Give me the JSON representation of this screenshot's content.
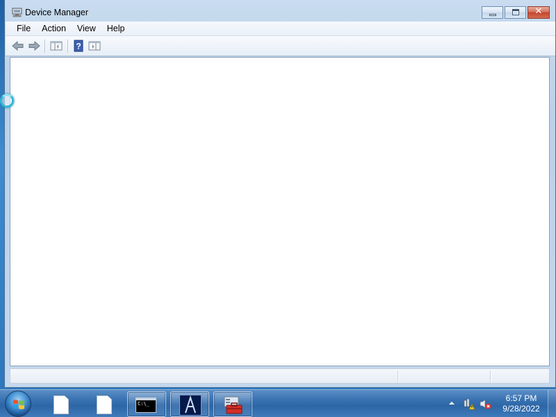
{
  "window": {
    "title": "Device Manager",
    "icon": "device-manager-icon",
    "caption_buttons": [
      "minimize",
      "maximize",
      "close"
    ]
  },
  "menubar": {
    "items": [
      "File",
      "Action",
      "View",
      "Help"
    ]
  },
  "toolbar": {
    "buttons": [
      "back-arrow-icon",
      "forward-arrow-icon",
      "show-hide-console-tree-icon",
      "help-icon",
      "show-hide-action-pane-icon"
    ]
  },
  "taskbar": {
    "apps": [
      "blank-document-icon",
      "blank-document-icon",
      "command-prompt-icon",
      "a-app-icon",
      "toolbox-icon"
    ],
    "clock": {
      "time": "6:57 PM",
      "date": "9/28/2022"
    },
    "tray_icons": [
      "show-hidden-icons-arrow",
      "network-warning-icon",
      "volume-muted-icon"
    ]
  },
  "colors": {
    "taskbar": "#3a73b2",
    "window_frame": "#c4d8ee",
    "close_button": "#c4462e",
    "busy_cursor": "#2fb6d6"
  }
}
